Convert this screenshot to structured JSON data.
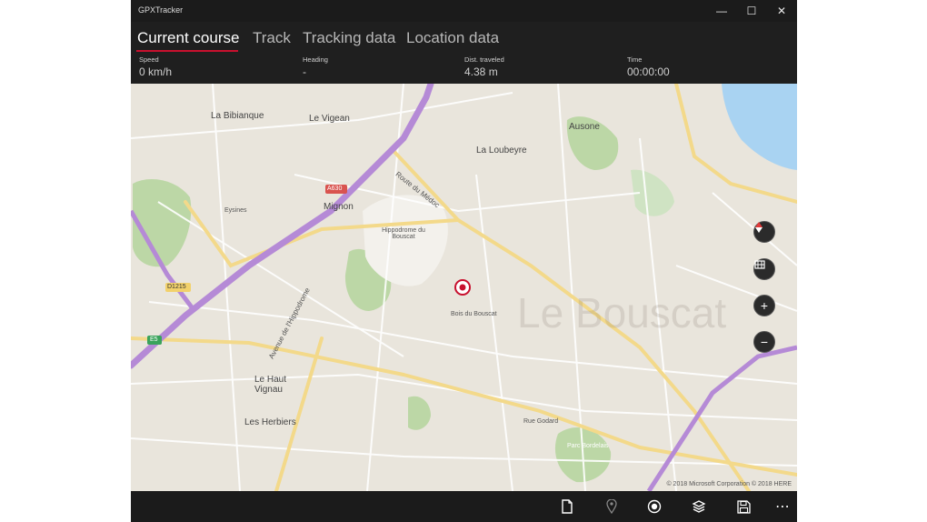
{
  "window": {
    "title": "GPXTracker"
  },
  "window_controls": {
    "minimize": "—",
    "maximize": "☐",
    "close": "✕"
  },
  "tabs": [
    {
      "label": "Current course",
      "active": true
    },
    {
      "label": "Track",
      "active": false
    },
    {
      "label": "Tracking data",
      "active": false
    },
    {
      "label": "Location data",
      "active": false
    }
  ],
  "stats": [
    {
      "label": "Speed",
      "value": "0 km/h"
    },
    {
      "label": "Heading",
      "value": "-"
    },
    {
      "label": "Dist. traveled",
      "value": "4.38 m"
    },
    {
      "label": "Time",
      "value": "00:00:00"
    }
  ],
  "map": {
    "watermark": "Le Bouscat",
    "copyright": "© 2018 Microsoft Corporation  © 2018 HERE",
    "places": [
      "La Bibianque",
      "Le Vigean",
      "La Loubeyre",
      "Ausone",
      "Mignon",
      "Hippodrome du Bouscat",
      "Le Haut Vignau",
      "Les Herbiers",
      "Parc Bordelais",
      "Route du Médoc",
      "Avenue de l'Hippodrome",
      "Rue Godard",
      "Eysines",
      "Bois du Bouscat"
    ],
    "road_badges": [
      "A630",
      "D1215",
      "E5"
    ],
    "controls": {
      "compass": "compass-icon",
      "map_style": "map-style-icon",
      "zoom_in": "+",
      "zoom_out": "−"
    }
  },
  "toolbar": {
    "items": [
      "new-file-icon",
      "location-pin-icon",
      "record-icon",
      "layers-icon",
      "save-icon",
      "more-icon"
    ],
    "more_label": "⋯"
  },
  "colors": {
    "accent": "#c8102e",
    "chrome": "#1f1f1f",
    "map_land": "#e9e5dc",
    "motorway": "#b58ad6",
    "major_road": "#f3d98a",
    "park": "#bcd7a6",
    "water": "#a9d3f2"
  }
}
